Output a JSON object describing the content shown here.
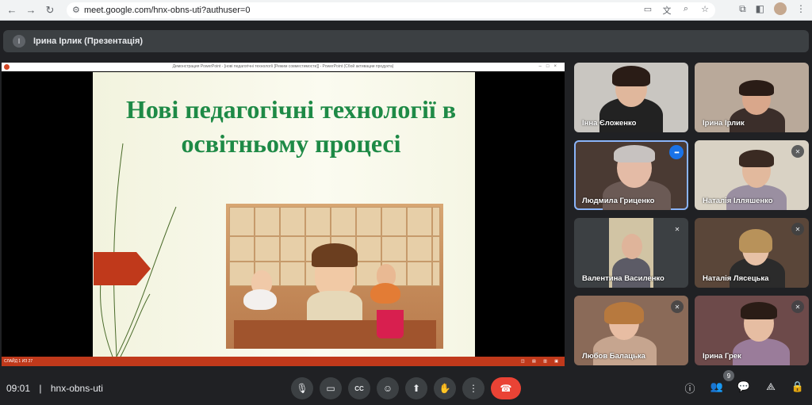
{
  "browser": {
    "url": "meet.google.com/hnx-obns-uti?authuser=0",
    "back_icon": "←",
    "forward_icon": "→",
    "reload_icon": "↻",
    "tune_icon": "⚙",
    "camera_icon": "▭",
    "translate_icon": "文",
    "zoom_icon": "⌕",
    "star_icon": "☆",
    "extensions_icon": "⧉",
    "sidepanel_icon": "◧",
    "menu_icon": "⋮"
  },
  "meeting": {
    "presenter_title": "Ірина Ірлик (Презентація)",
    "presenter_initial": "І",
    "time": "09:01",
    "separator": "|",
    "code": "hnx-obns-uti",
    "participants_count": "9"
  },
  "presentation": {
    "window_title": "Демонстрация PowerPoint - [нові педагогічні технології [Режим совместимости]] - PowerPoint (Сбой активации продукта)",
    "window_controls": "–□×",
    "slide_title": "Нові педагогічні технології в освітньому процесі",
    "status_left": "СЛАЙД 1 ИЗ 27",
    "status_right": "◫ ▤ ▥ ▣"
  },
  "participants": [
    {
      "name": "Інна Єложенко",
      "muted": false,
      "speaking": false
    },
    {
      "name": "Ірина Ірлик",
      "muted": false,
      "speaking": false
    },
    {
      "name": "Людмила Гриценко",
      "muted": false,
      "speaking": true
    },
    {
      "name": "Наталія Ілляшенко",
      "muted": true,
      "speaking": false
    },
    {
      "name": "Валентина Василенко",
      "muted": true,
      "speaking": false
    },
    {
      "name": "Наталія Лясецька",
      "muted": true,
      "speaking": false
    },
    {
      "name": "Любов Балацька",
      "muted": true,
      "speaking": false
    },
    {
      "name": "Ірина Грек",
      "muted": true,
      "speaking": false
    }
  ],
  "controls": {
    "mic_icon": "🎙",
    "camera_icon": "▭",
    "captions_icon": "CC",
    "emoji_icon": "☺",
    "present_icon": "⬆",
    "hand_icon": "✋",
    "more_icon": "⋮",
    "hangup_icon": "☎",
    "info_icon": "ⓘ",
    "people_icon": "👥",
    "chat_icon": "💬",
    "activities_icon": "⟁",
    "host_icon": "🔒",
    "muted_icon": "✕",
    "speaking_icon": "•••"
  },
  "colors": {
    "slide_title": "#1e8a46",
    "accent_red": "#c0391b",
    "hangup": "#ea4335",
    "active_outline": "#8ab4f8"
  }
}
